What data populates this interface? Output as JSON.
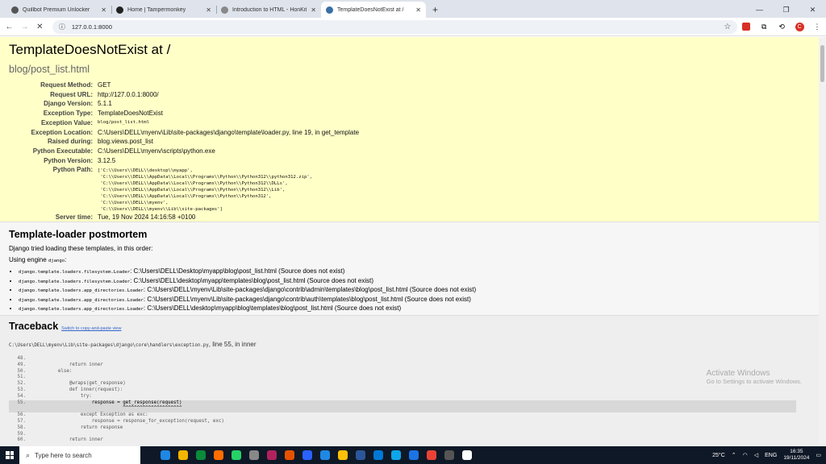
{
  "browser": {
    "tabs": [
      {
        "label": "Quillbot Premium Unlocker",
        "color": "#555555"
      },
      {
        "label": "Home | Tampermonkey",
        "color": "#222222"
      },
      {
        "label": "Introduction to HTML - HonKit",
        "color": "#888888"
      },
      {
        "label": "TemplateDoesNotExist at /",
        "color": "#3a6ea5"
      }
    ],
    "url": "127.0.0.1:8000"
  },
  "error": {
    "title": "TemplateDoesNotExist at /",
    "subtitle": "blog/post_list.html",
    "meta": [
      {
        "key": "Request Method:",
        "value": "GET"
      },
      {
        "key": "Request URL:",
        "value": "http://127.0.0.1:8000/"
      },
      {
        "key": "Django Version:",
        "value": "5.1.1"
      },
      {
        "key": "Exception Type:",
        "value": "TemplateDoesNotExist"
      },
      {
        "key": "Exception Value:",
        "value": "blog/post_list.html"
      },
      {
        "key": "Exception Location:",
        "value": "C:\\Users\\DELL\\myenv\\Lib\\site-packages\\django\\template\\loader.py, line 19, in get_template"
      },
      {
        "key": "Raised during:",
        "value": "blog.views.post_list"
      },
      {
        "key": "Python Executable:",
        "value": "C:\\Users\\DELL\\myenv\\scripts\\python.exe"
      },
      {
        "key": "Python Version:",
        "value": "3.12.5"
      },
      {
        "key": "Python Path:",
        "value": "['C:\\\\Users\\\\DELL\\\\desktop\\\\myapp',\n 'C:\\\\Users\\\\DELL\\\\AppData\\\\Local\\\\Programs\\\\Python\\\\Python312\\\\python312.zip',\n 'C:\\\\Users\\\\DELL\\\\AppData\\\\Local\\\\Programs\\\\Python\\\\Python312\\\\DLLs',\n 'C:\\\\Users\\\\DELL\\\\AppData\\\\Local\\\\Programs\\\\Python\\\\Python312\\\\Lib',\n 'C:\\\\Users\\\\DELL\\\\AppData\\\\Local\\\\Programs\\\\Python\\\\Python312',\n 'C:\\\\Users\\\\DELL\\\\myenv',\n 'C:\\\\Users\\\\DELL\\\\myenv\\\\Lib\\\\site-packages']"
      },
      {
        "key": "Server time:",
        "value": "Tue, 19 Nov 2024 14:16:58 +0100"
      }
    ]
  },
  "postmortem": {
    "heading": "Template-loader postmortem",
    "intro": "Django tried loading these templates, in this order:",
    "engine_prefix": "Using engine",
    "engine": "django",
    "items": [
      {
        "loader": "django.template.loaders.filesystem.Loader",
        "path": ": C:\\Users\\DELL\\Desktop\\myapp\\blog\\post_list.html (Source does not exist)"
      },
      {
        "loader": "django.template.loaders.filesystem.Loader",
        "path": ": C:\\Users\\DELL\\desktop\\myapp\\templates\\blog\\post_list.html (Source does not exist)"
      },
      {
        "loader": "django.template.loaders.app_directories.Loader",
        "path": ": C:\\Users\\DELL\\myenv\\Lib\\site-packages\\django\\contrib\\admin\\templates\\blog\\post_list.html (Source does not exist)"
      },
      {
        "loader": "django.template.loaders.app_directories.Loader",
        "path": ": C:\\Users\\DELL\\myenv\\Lib\\site-packages\\django\\contrib\\auth\\templates\\blog\\post_list.html (Source does not exist)"
      },
      {
        "loader": "django.template.loaders.app_directories.Loader",
        "path": ": C:\\Users\\DELL\\desktop\\myapp\\blog\\templates\\blog\\post_list.html (Source does not exist)"
      }
    ]
  },
  "traceback": {
    "heading": "Traceback",
    "switch_link": "Switch to copy-and-paste view",
    "file": "C:\\Users\\DELL\\myenv\\Lib\\site-packages\\django\\core\\handlers\\exception.py",
    "location": ", line 55, in inner",
    "lines": [
      {
        "n": "48.",
        "code": ""
      },
      {
        "n": "49.",
        "code": "            return inner"
      },
      {
        "n": "50.",
        "code": "        else:"
      },
      {
        "n": "51.",
        "code": ""
      },
      {
        "n": "52.",
        "code": "            @wraps(get_response)"
      },
      {
        "n": "53.",
        "code": "            def inner(request):"
      },
      {
        "n": "54.",
        "code": "                try:"
      },
      {
        "n": "55.",
        "code": "                    response = get_response(request)\n                               ^^^^^^^^^^^^^^^^^^^^^",
        "highlight": true
      },
      {
        "n": "56.",
        "code": "                except Exception as exc:"
      },
      {
        "n": "57.",
        "code": "                    response = response_for_exception(request, exc)"
      },
      {
        "n": "58.",
        "code": "                return response"
      },
      {
        "n": "59.",
        "code": ""
      },
      {
        "n": "60.",
        "code": "            return inner"
      }
    ]
  },
  "watermark": {
    "line1": "Activate Windows",
    "line2": "Go to Settings to activate Windows."
  },
  "taskbar": {
    "search_placeholder": "Type here to search",
    "weather": "25°C",
    "lang": "ENG",
    "time": "16:35",
    "date": "19/11/2024",
    "apps": [
      "#1e88e5",
      "#f4b400",
      "#0a8a3a",
      "#ff6d00",
      "#25d366",
      "#888888",
      "#b0225e",
      "#e65100",
      "#2962ff",
      "#1e88e5",
      "#ffc107",
      "#2b579a",
      "#0078d4",
      "#0ea5e9",
      "#1b74e4",
      "#ea4335",
      "#555555",
      "#ffffff"
    ]
  }
}
